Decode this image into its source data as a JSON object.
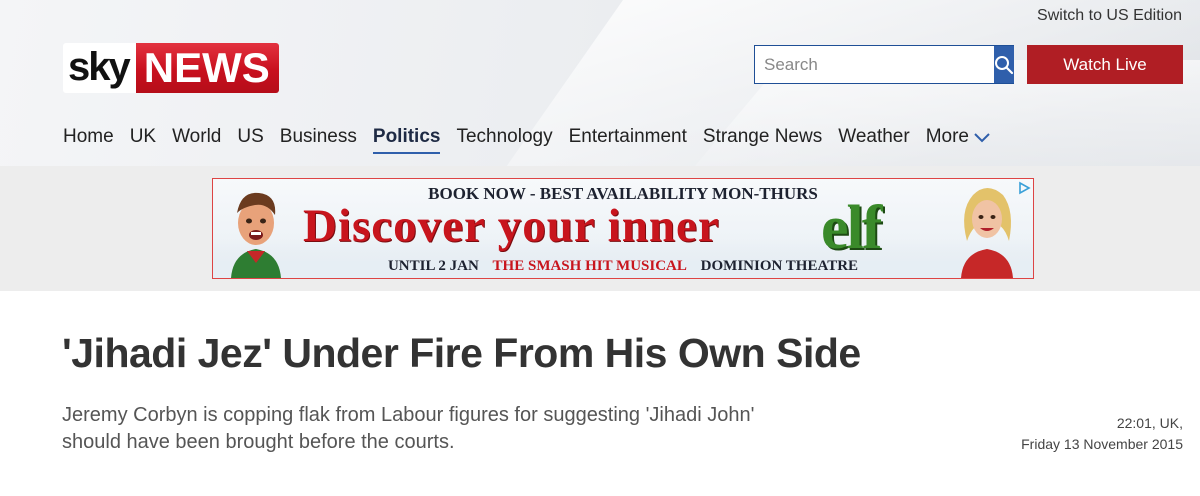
{
  "header": {
    "edition_link": "Switch to US Edition",
    "logo": {
      "sky": "sky",
      "news": "NEWS"
    },
    "search": {
      "placeholder": "Search",
      "value": ""
    },
    "watch_live": "Watch Live"
  },
  "nav": {
    "items": [
      "Home",
      "UK",
      "World",
      "US",
      "Business",
      "Politics",
      "Technology",
      "Entertainment",
      "Strange News",
      "Weather"
    ],
    "active": "Politics",
    "more": "More"
  },
  "ad": {
    "top_line": "BOOK NOW - BEST AVAILABILITY MON-THURS",
    "main_line": "Discover your inner",
    "brand": "elf",
    "bottom_left": "UNTIL 2 JAN",
    "bottom_mid": "THE SMASH HIT MUSICAL",
    "bottom_right": "DOMINION THEATRE"
  },
  "article": {
    "headline": "'Jihadi Jez' Under Fire From His Own Side",
    "standfirst": "Jeremy Corbyn is copping flak from Labour figures for suggesting 'Jihadi John' should have been brought before the courts.",
    "time": "22:01, UK,",
    "date": "Friday 13 November 2015"
  },
  "colors": {
    "brand_red": "#c8101e",
    "search_blue": "#2f5fab",
    "watch_live_red": "#b01e24"
  }
}
